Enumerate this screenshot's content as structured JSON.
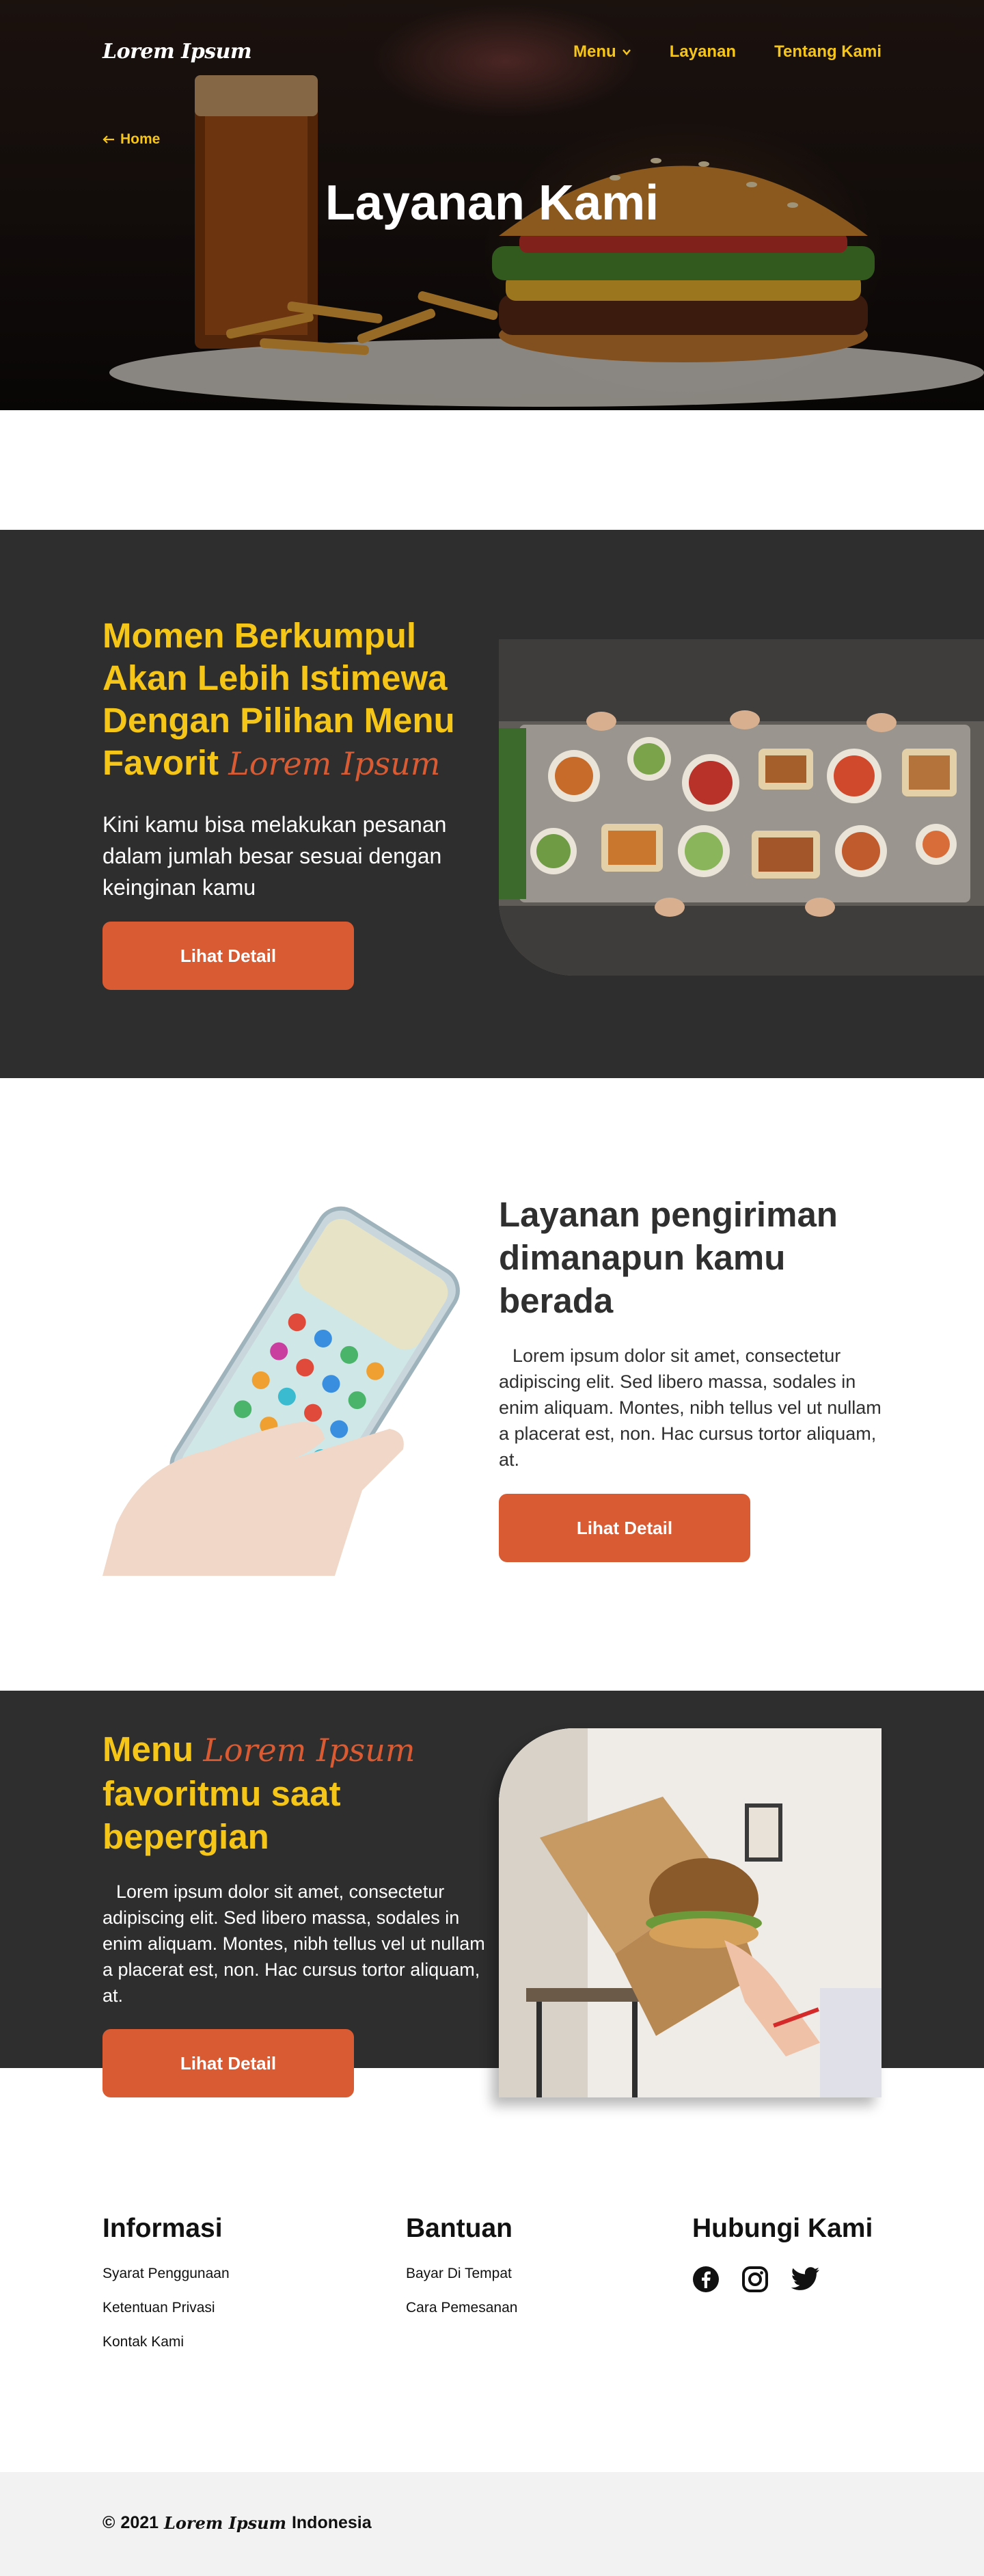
{
  "header": {
    "logo": "Lorem Ipsum",
    "nav": [
      {
        "label": "Menu",
        "has_dropdown": true
      },
      {
        "label": "Layanan",
        "has_dropdown": false
      },
      {
        "label": "Tentang Kami",
        "has_dropdown": false
      }
    ],
    "breadcrumb_back": "Home",
    "title": "Layanan Kami"
  },
  "section_gathering": {
    "heading": "Momen Berkumpul Akan Lebih Istimewa Dengan Pilihan Menu Favorit",
    "brand": "Lorem Ipsum",
    "body": "Kini kamu bisa melakukan pesanan dalam jumlah besar sesuai dengan keinginan kamu",
    "button": "Lihat Detail"
  },
  "section_delivery": {
    "heading": "Layanan pengiriman dimanapun kamu berada",
    "body": "Lorem ipsum dolor sit amet, consectetur adipiscing elit. Sed libero massa, sodales in enim aliquam. Montes, nibh tellus vel ut nullam a placerat est, non. Hac cursus tortor aliquam, at.",
    "button": "Lihat Detail"
  },
  "section_travel": {
    "heading_prefix": "Menu",
    "brand": "Lorem Ipsum",
    "heading_suffix": "favoritmu saat bepergian",
    "body": "Lorem ipsum dolor sit amet, consectetur adipiscing elit. Sed libero massa, sodales in enim aliquam. Montes, nibh tellus vel ut nullam a placerat est, non. Hac cursus tortor aliquam, at.",
    "button": "Lihat Detail"
  },
  "footer": {
    "columns": [
      {
        "title": "Informasi",
        "links": [
          "Syarat Penggunaan",
          "Ketentuan Privasi",
          "Kontak Kami"
        ]
      },
      {
        "title": "Bantuan",
        "links": [
          "Bayar Di Tempat",
          "Cara Pemesanan"
        ]
      }
    ],
    "contact_title": "Hubungi Kami",
    "social_icons": [
      "facebook-icon",
      "instagram-icon",
      "twitter-icon"
    ],
    "copyright_symbol": "©",
    "copyright_year": "2021",
    "copyright_brand": "Lorem Ipsum",
    "copyright_country": "Indonesia"
  },
  "colors": {
    "accent_yellow": "#f5c518",
    "accent_orange": "#d95b33",
    "dark_bg": "#2e2e2e",
    "footer_bg": "#f2f2f2"
  }
}
